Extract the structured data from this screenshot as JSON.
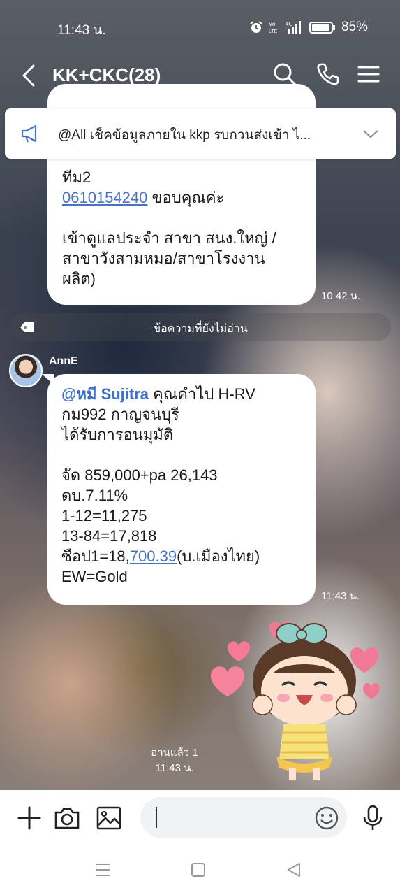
{
  "status_bar": {
    "time": "11:43 น.",
    "battery": "85%",
    "network": "4G",
    "volte": "Vo LTE"
  },
  "header": {
    "title": "KK+CKC(28)"
  },
  "announcement": {
    "text": "@All  เช็คข้อมูลภายใน kkp รบกวนส่งเข้า ไ..."
  },
  "messages": [
    {
      "lines": [
        "ทีม2"
      ],
      "phone": "0610154240",
      "phone_suffix": " ขอบคุณค่ะ",
      "lines2": [
        "เข้าดูแลประจำ สาขา สนง.ใหญ่ /",
        "สาขาวังสามหมอ/สาขาโรงงาน",
        "ผลิต)"
      ],
      "time": "10:42 น."
    },
    {
      "sender": "AnnE",
      "mention": "@หมี Sujitra",
      "first_line_rest": " คุณคำไป H-RV",
      "lines": [
        "กม992 กาญจนบุรี",
        "ได้รับการอนมุมัติ",
        "",
        "จัด 859,000+pa 26,143",
        "ดบ.7.11%",
        "1-12=11,275",
        "13-84=17,818"
      ],
      "last_prefix": "ซือป1=18,",
      "last_link": "700.39",
      "last_suffix": "(บ.เมืองไทย)",
      "final_line": "EW=Gold",
      "time": "11:43 น."
    }
  ],
  "unread_divider": "ข้อความที่ยังไม่อ่าน",
  "read_status": {
    "label": "อ่านแล้ว 1",
    "time": "11:43 น."
  },
  "input": {
    "placeholder": ""
  },
  "colors": {
    "link": "#4a72c4",
    "bubble": "#ffffff",
    "accent": "#3f6fc7"
  }
}
